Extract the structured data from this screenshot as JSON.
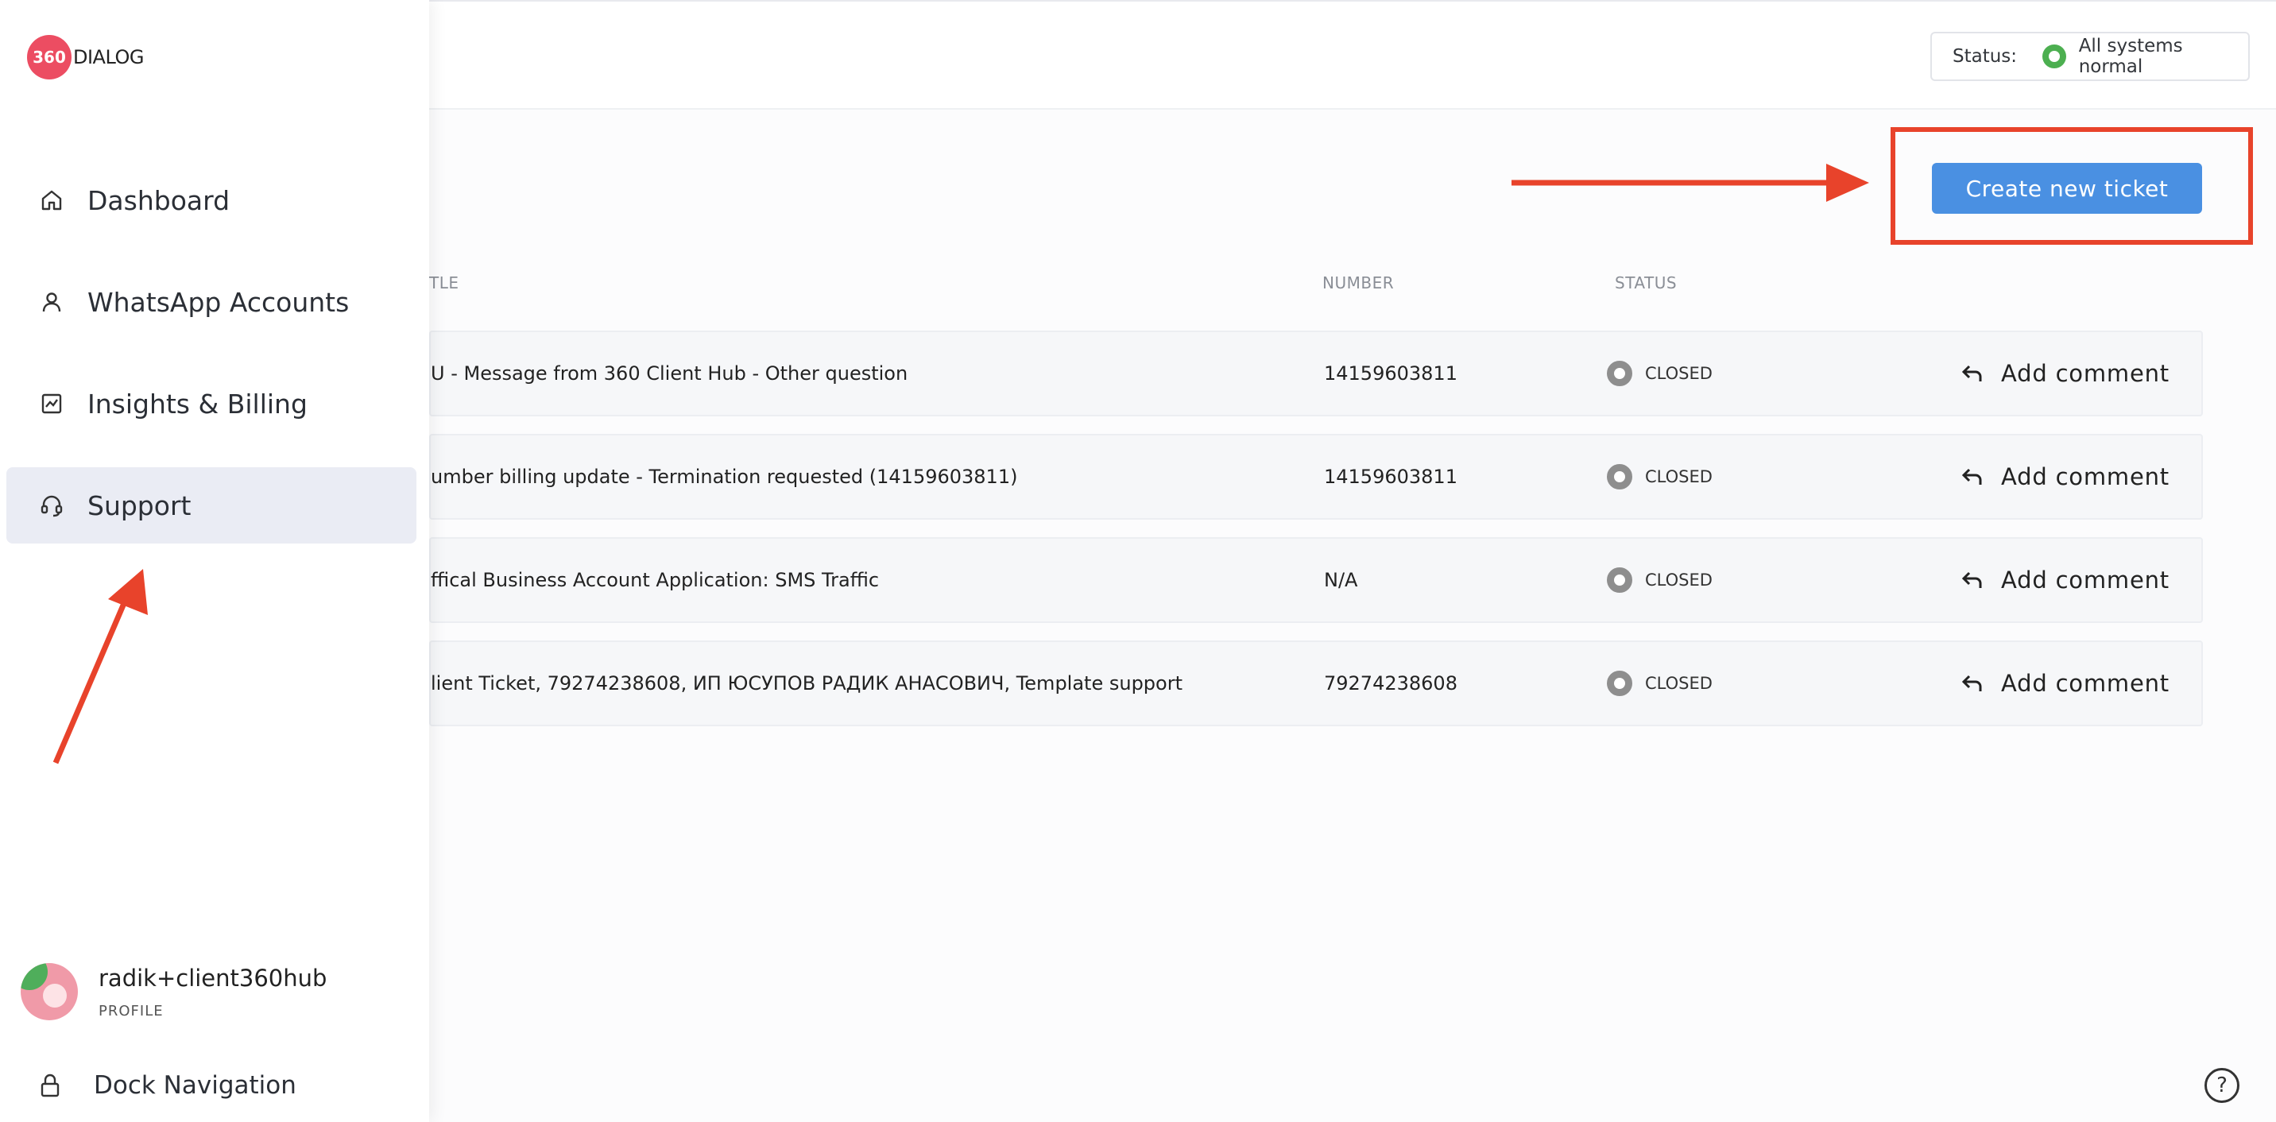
{
  "brand": {
    "badge_text": "360",
    "word": "DIALOG",
    "color": "#ec4d62"
  },
  "status": {
    "label": "Status:",
    "value": "All systems normal",
    "color": "#4caf50"
  },
  "sidebar": {
    "items": [
      {
        "label": "Dashboard",
        "icon": "home-icon"
      },
      {
        "label": "WhatsApp Accounts",
        "icon": "user-icon"
      },
      {
        "label": "Insights & Billing",
        "icon": "chart-icon"
      },
      {
        "label": "Support",
        "icon": "headset-icon",
        "active": true
      }
    ],
    "profile": {
      "name": "radik+client360hub",
      "sub": "PROFILE"
    },
    "dock": {
      "label": "Dock Navigation",
      "icon": "lock-icon"
    }
  },
  "actions": {
    "create_ticket": "Create new ticket",
    "accent": "#4a90e2"
  },
  "table": {
    "headers": {
      "title": "TLE",
      "number": "NUMBER",
      "status": "STATUS"
    },
    "rows": [
      {
        "title": "U - Message from 360 Client Hub - Other question",
        "number": "14159603811",
        "status": "CLOSED",
        "action": "Add comment"
      },
      {
        "title": "umber billing update - Termination requested (14159603811)",
        "number": "14159603811",
        "status": "CLOSED",
        "action": "Add comment"
      },
      {
        "title": "ffical Business Account Application: SMS Traffic",
        "number": "N/A",
        "status": "CLOSED",
        "action": "Add comment"
      },
      {
        "title": "lient Ticket, 79274238608, ИП ЮСУПОВ РАДИК АНАСОВИЧ, Template support",
        "number": "79274238608",
        "status": "CLOSED",
        "action": "Add comment"
      }
    ]
  },
  "annotations": {
    "color": "#e8432b"
  },
  "help": {
    "glyph": "?"
  }
}
